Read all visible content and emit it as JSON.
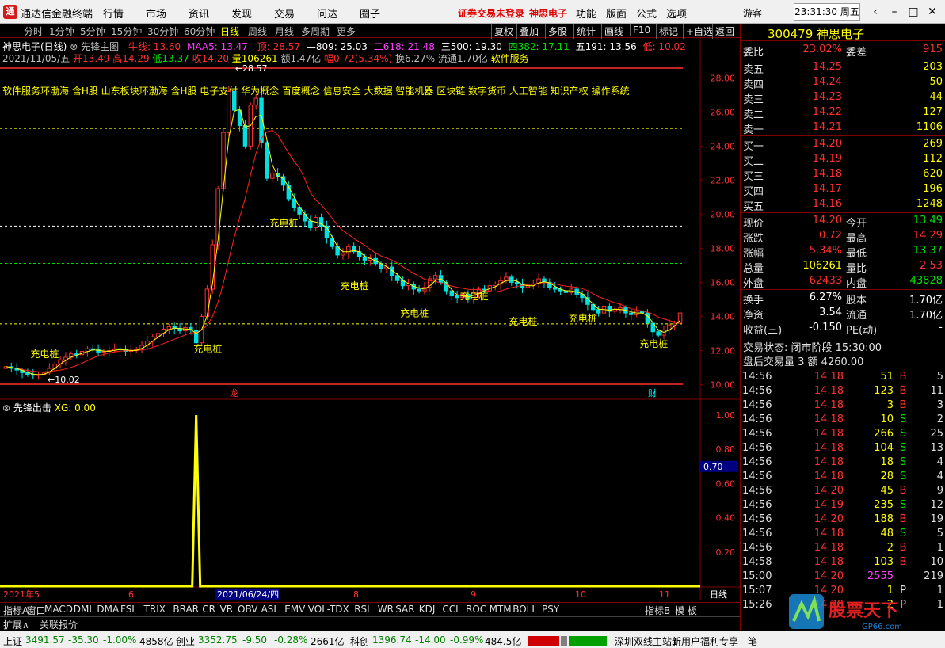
{
  "app": {
    "logo": "通",
    "title": "通达信金融终端",
    "menus": [
      "行情",
      "市场",
      "资讯",
      "发现",
      "交易",
      "问达",
      "圈子"
    ],
    "warning": "证券交易未登录",
    "stock_name_menu": "神思电子",
    "menus2": [
      "功能",
      "版面",
      "公式",
      "选项"
    ],
    "user": "游客",
    "clock": "23:31:30 周五"
  },
  "period_tabs": [
    "分时",
    "1分钟",
    "5分钟",
    "15分钟",
    "30分钟",
    "60分钟",
    "日线",
    "周线",
    "月线",
    "多周期",
    "更多"
  ],
  "period_active": "日线",
  "toolbar_buttons": [
    "复权",
    "叠加",
    "多股",
    "统计",
    "画线",
    "F10",
    "标记",
    "+自选",
    "返回"
  ],
  "chart": {
    "stock_label": "神思电子(日线)",
    "indicator_main": "先锋主图",
    "niu_label": "牛线: 13.60",
    "maa_label": "MAA5: 13.47",
    "ding_label": "顶: 28.57",
    "l809": "—809: 25.03",
    "l618": "二618: 21.48",
    "l500": "三500: 19.30",
    "l382": "四382: 17.11",
    "l191": "五191: 13.56",
    "di_label": "低: 10.02",
    "date": "2021/11/05/五",
    "open": "开13.49",
    "high": "高14.29",
    "low": "低13.37",
    "close": "收14.20",
    "vol": "量106261",
    "amount": "额1.47亿",
    "chg": "幅0.72(5.34%)",
    "turnover": "换6.27%",
    "float": "流通1.70亿",
    "industry": "软件服务",
    "concepts": "软件服务环渤海 含H股 山东板块环渤海 含H股 电子支付 华为概念 百度概念 信息安全 大数据 智能机器 区块链 数字货币 人工智能 知识产权 操作系统",
    "peak_label": "28.57",
    "low_label": "10.02",
    "signal_label": "充电桩",
    "tag_longhu": "龙",
    "tag_cai": "财",
    "y_ticks": [
      "28.00",
      "26.00",
      "24.00",
      "22.00",
      "20.00",
      "18.00",
      "16.00",
      "14.00",
      "12.00",
      "10.00"
    ],
    "sub_indicator": "先锋出击",
    "xg_label": "XG: 0.00",
    "sub_ticks": [
      "1.00",
      "0.80",
      "0.60",
      "0.40",
      "0.20"
    ],
    "sub_cursor": "0.70",
    "x_labels": [
      "2021年5",
      "6",
      "8",
      "9",
      "10",
      "11"
    ],
    "x_cursor": "2021/06/24/四",
    "period_tag": "日线"
  },
  "chart_data": {
    "type": "candlestick",
    "title": "神思电子(日线)",
    "yrange": [
      10.02,
      28.57
    ],
    "fib_levels": [
      {
        "name": "顶",
        "value": 28.57
      },
      {
        "name": "809",
        "value": 25.03
      },
      {
        "name": "618",
        "value": 21.48
      },
      {
        "name": "500",
        "value": 19.3
      },
      {
        "name": "382",
        "value": 17.11
      },
      {
        "name": "191",
        "value": 13.56
      },
      {
        "name": "低",
        "value": 10.02
      }
    ],
    "close": [
      11.05,
      10.95,
      10.85,
      10.7,
      10.6,
      10.55,
      10.58,
      10.68,
      10.95,
      11.2,
      11.45,
      11.6,
      11.8,
      11.75,
      11.95,
      12.1,
      12.05,
      11.9,
      11.95,
      12.0,
      12.1,
      12.05,
      11.95,
      12.0,
      12.05,
      12.3,
      12.55,
      12.8,
      13.0,
      13.25,
      13.4,
      13.3,
      13.15,
      13.35,
      13.2,
      12.45,
      14.0,
      15.6,
      18.2,
      21.5,
      24.8,
      27.2,
      26.1,
      25.2,
      24.0,
      26.4,
      26.8,
      24.2,
      22.1,
      22.4,
      22.2,
      21.7,
      20.9,
      20.4,
      20.0,
      19.6,
      19.2,
      19.8,
      19.3,
      18.6,
      18.1,
      17.6,
      17.7,
      18.1,
      17.8,
      17.5,
      17.3,
      17.4,
      17.1,
      16.8,
      16.9,
      16.4,
      16.1,
      15.8,
      15.9,
      15.6,
      15.5,
      15.7,
      16.2,
      16.4,
      16.0,
      15.5,
      15.2,
      15.1,
      15.3,
      15.0,
      15.4,
      15.6,
      15.5,
      15.8,
      15.9,
      16.1,
      16.3,
      16.0,
      15.9,
      15.7,
      15.8,
      15.9,
      16.2,
      16.0,
      15.7,
      15.6,
      15.5,
      15.4,
      15.6,
      15.3,
      15.1,
      14.7,
      14.4,
      14.2,
      14.6,
      14.3,
      14.4,
      14.5,
      14.2,
      14.1,
      14.3,
      14.2,
      13.6,
      13.1,
      12.9,
      13.2,
      13.5,
      13.6,
      14.2
    ],
    "sub_indicator": {
      "name": "XG",
      "spike_index": 35,
      "spike_value": 1.0
    }
  },
  "quote": {
    "code_name": "300479 神思电子",
    "weibi_label": "委比",
    "weibi": "23.02%",
    "weicha_label": "委差",
    "weicha": "915",
    "asks": [
      {
        "label": "卖五",
        "price": "14.25",
        "vol": "203"
      },
      {
        "label": "卖四",
        "price": "14.24",
        "vol": "50"
      },
      {
        "label": "卖三",
        "price": "14.23",
        "vol": "44"
      },
      {
        "label": "卖二",
        "price": "14.22",
        "vol": "127"
      },
      {
        "label": "卖一",
        "price": "14.21",
        "vol": "1106"
      }
    ],
    "bids": [
      {
        "label": "买一",
        "price": "14.20",
        "vol": "269"
      },
      {
        "label": "买二",
        "price": "14.19",
        "vol": "112"
      },
      {
        "label": "买三",
        "price": "14.18",
        "vol": "620"
      },
      {
        "label": "买四",
        "price": "14.17",
        "vol": "196"
      },
      {
        "label": "买五",
        "price": "14.16",
        "vol": "1248"
      }
    ],
    "stats": [
      {
        "l1": "现价",
        "v1": "14.20",
        "c1": "red",
        "l2": "今开",
        "v2": "13.49",
        "c2": "green"
      },
      {
        "l1": "涨跌",
        "v1": "0.72",
        "c1": "red",
        "l2": "最高",
        "v2": "14.29",
        "c2": "red"
      },
      {
        "l1": "涨幅",
        "v1": "5.34%",
        "c1": "red",
        "l2": "最低",
        "v2": "13.37",
        "c2": "green"
      },
      {
        "l1": "总量",
        "v1": "106261",
        "c1": "yellow",
        "l2": "量比",
        "v2": "2.53",
        "c2": "red"
      },
      {
        "l1": "外盘",
        "v1": "62433",
        "c1": "red",
        "l2": "内盘",
        "v2": "43828",
        "c2": "green"
      }
    ],
    "stats2": [
      {
        "l1": "换手",
        "v1": "6.27%",
        "l2": "股本",
        "v2": "1.70亿"
      },
      {
        "l1": "净资",
        "v1": "3.54",
        "l2": "流通",
        "v2": "1.70亿"
      },
      {
        "l1": "收益(三)",
        "v1": "-0.150",
        "l2": "PE(动)",
        "v2": "-"
      }
    ],
    "trade_state": "交易状态: 闭市阶段 15:30:00",
    "after_hours": "盘后交易量 3 额 4260.00",
    "ticks": [
      {
        "t": "14:56",
        "p": "14.18",
        "v": "51",
        "s": "B",
        "n": "5"
      },
      {
        "t": "14:56",
        "p": "14.18",
        "v": "123",
        "s": "B",
        "n": "11"
      },
      {
        "t": "14:56",
        "p": "14.18",
        "v": "3",
        "s": "B",
        "n": "3"
      },
      {
        "t": "14:56",
        "p": "14.18",
        "v": "10",
        "s": "S",
        "n": "2"
      },
      {
        "t": "14:56",
        "p": "14.18",
        "v": "266",
        "s": "S",
        "n": "25"
      },
      {
        "t": "14:56",
        "p": "14.18",
        "v": "104",
        "s": "S",
        "n": "13"
      },
      {
        "t": "14:56",
        "p": "14.18",
        "v": "18",
        "s": "S",
        "n": "4"
      },
      {
        "t": "14:56",
        "p": "14.18",
        "v": "28",
        "s": "S",
        "n": "4"
      },
      {
        "t": "14:56",
        "p": "14.20",
        "v": "45",
        "s": "B",
        "n": "9"
      },
      {
        "t": "14:56",
        "p": "14.19",
        "v": "235",
        "s": "S",
        "n": "12"
      },
      {
        "t": "14:56",
        "p": "14.20",
        "v": "188",
        "s": "B",
        "n": "19"
      },
      {
        "t": "14:56",
        "p": "14.18",
        "v": "48",
        "s": "S",
        "n": "5"
      },
      {
        "t": "14:56",
        "p": "14.18",
        "v": "2",
        "s": "B",
        "n": "1"
      },
      {
        "t": "14:58",
        "p": "14.18",
        "v": "103",
        "s": "B",
        "n": "10"
      },
      {
        "t": "15:00",
        "p": "14.20",
        "v": "2555",
        "s": "",
        "n": "219"
      },
      {
        "t": "15:07",
        "p": "14.20",
        "v": "1",
        "s": "P",
        "n": "1"
      },
      {
        "t": "15:26",
        "p": "14.20",
        "v": "2",
        "s": "P",
        "n": "1"
      }
    ]
  },
  "indicator_tabs": [
    "指标A",
    "窗口",
    "MACD",
    "DMI",
    "DMA",
    "FSL",
    "TRIX",
    "BRAR",
    "CR",
    "VR",
    "OBV",
    "ASI",
    "EMV",
    "VOL-TDX",
    "RSI",
    "WR",
    "SAR",
    "KDJ",
    "CCI",
    "ROC",
    "MTM",
    "BOLL",
    "PSY"
  ],
  "indicator_b": "指标B",
  "template_tab": "模 板",
  "ext_tabs": [
    "扩展∧",
    "关联报价"
  ],
  "statusbar": {
    "sh_label": "上证",
    "sh": "3491.57",
    "sh_chg": "-35.30",
    "sh_pct": "-1.00%",
    "sh_amt": "4858亿",
    "cy_label": "创业",
    "cy": "3352.75",
    "cy_chg": "-9.50",
    "cy_pct": "-0.28%",
    "cy_amt": "2661亿",
    "kc_label": "科创",
    "kc": "1396.74",
    "kc_chg": "-14.00",
    "kc_pct": "-0.99%",
    "kc_amt": "484.5亿",
    "station": "深圳双线主站1",
    "ad": "新用户福利专享",
    "pen": "笔"
  },
  "watermark": {
    "brand": "股票天下",
    "domain": "GP66.com"
  },
  "colors": {
    "up": "#ff3030",
    "down": "#00e0e0",
    "bg": "#000000",
    "axis": "#800000",
    "ma": "#ffff00"
  }
}
